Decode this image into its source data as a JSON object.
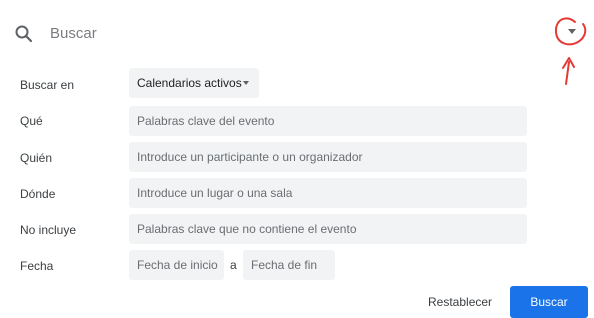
{
  "search": {
    "placeholder": "Buscar",
    "icon": "search-icon",
    "dropdown_icon": "arrow-drop-down-icon"
  },
  "annotation": {
    "color": "#e53935",
    "shapes": [
      "circle",
      "arrow"
    ]
  },
  "form": {
    "search_in": {
      "label": "Buscar en",
      "value": "Calendarios activos"
    },
    "what": {
      "label": "Qué",
      "placeholder": "Palabras clave del evento"
    },
    "who": {
      "label": "Quién",
      "placeholder": "Introduce un participante o un organizador"
    },
    "where": {
      "label": "Dónde",
      "placeholder": "Introduce un lugar o una sala"
    },
    "excludes": {
      "label": "No incluye",
      "placeholder": "Palabras clave que no contiene el evento"
    },
    "date": {
      "label": "Fecha",
      "start_placeholder": "Fecha de inicio",
      "separator": "a",
      "end_placeholder": "Fecha de fin"
    }
  },
  "actions": {
    "reset_label": "Restablecer",
    "search_label": "Buscar",
    "accent_color": "#1a73e8"
  }
}
